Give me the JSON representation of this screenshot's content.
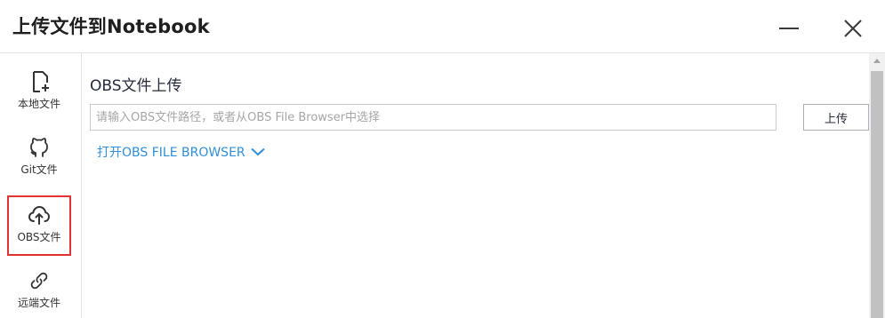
{
  "window": {
    "title": "上传文件到Notebook",
    "minimize_icon": "minimize-icon",
    "close_icon": "close-icon"
  },
  "sidebar": {
    "items": [
      {
        "label": "本地文件",
        "icon": "local-file-add-icon",
        "active": false
      },
      {
        "label": "Git文件",
        "icon": "github-icon",
        "active": false
      },
      {
        "label": "OBS文件",
        "icon": "cloud-upload-icon",
        "active": true
      },
      {
        "label": "远端文件",
        "icon": "link-icon",
        "active": false
      }
    ]
  },
  "main": {
    "section_title": "OBS文件上传",
    "path_input": {
      "value": "",
      "placeholder": "请输入OBS文件路径，或者从OBS File Browser中选择"
    },
    "upload_label": "上传",
    "browser_link_label": "打开OBS FILE BROWSER",
    "browser_link_icon": "chevron-down-icon"
  },
  "colors": {
    "link": "#2f8fd8",
    "active_border": "#e23232",
    "text": "#252b3a"
  }
}
